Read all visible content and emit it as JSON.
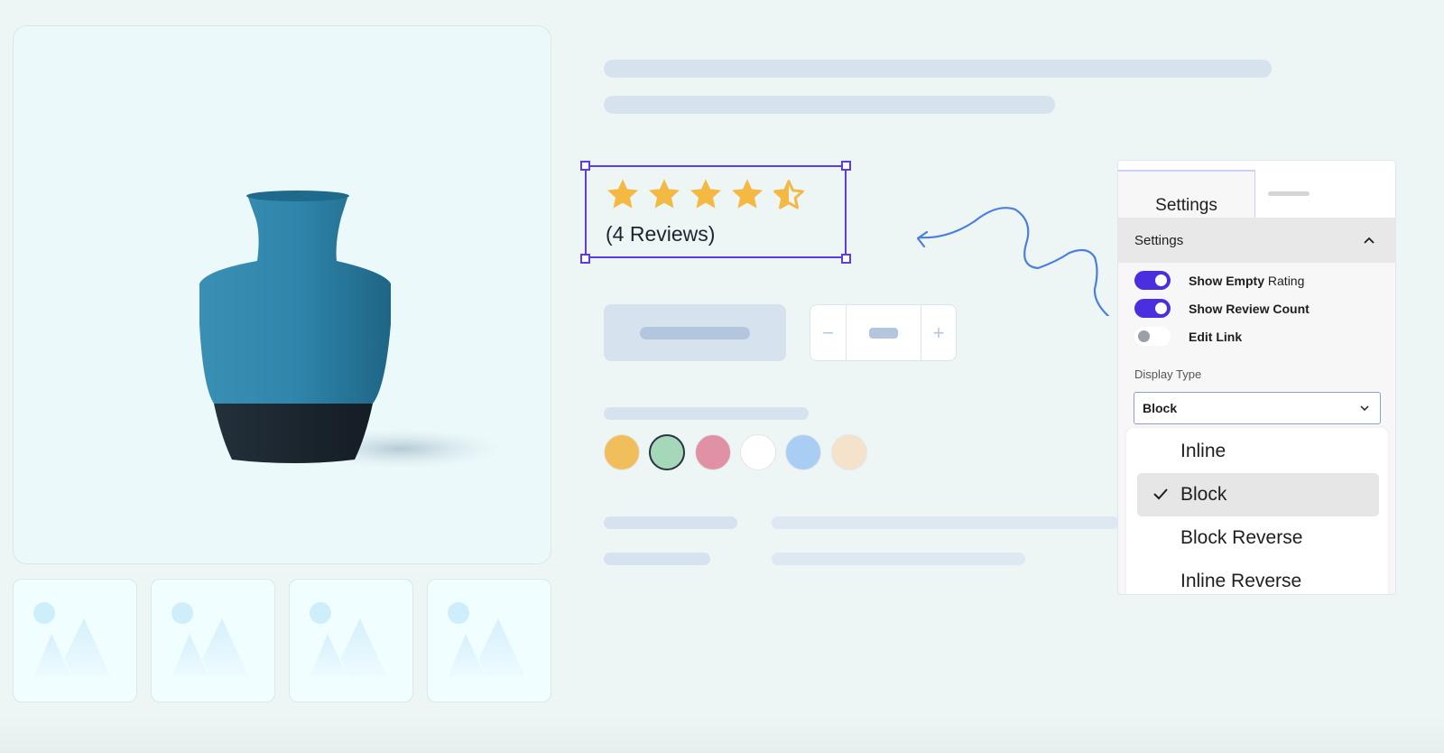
{
  "product": {
    "image_alt": "blue-ceramic-vase",
    "thumbnail_count": 4
  },
  "rating": {
    "stars_value": 4.5,
    "stars_max": 5,
    "reviews_label": "(4 Reviews)",
    "star_color": "#f4b942",
    "selection_color": "#5a3de6"
  },
  "quantity": {
    "minus_symbol": "−",
    "plus_symbol": "+"
  },
  "swatches": [
    {
      "name": "yellow",
      "color": "#f0be5a",
      "selected": false
    },
    {
      "name": "green",
      "color": "#a4d8b9",
      "selected": true
    },
    {
      "name": "pink",
      "color": "#e091a6",
      "selected": false
    },
    {
      "name": "white",
      "color": "#ffffff",
      "selected": false
    },
    {
      "name": "blue",
      "color": "#a9cdf3",
      "selected": false
    },
    {
      "name": "cream",
      "color": "#f4e2ca",
      "selected": false
    }
  ],
  "panel": {
    "tab_active": "Settings",
    "section_title": "Settings",
    "toggles": [
      {
        "label_main": "Show Empty",
        "label_suffix": "Rating",
        "on": true
      },
      {
        "label_main": "Show Review Count",
        "label_suffix": "",
        "on": true
      },
      {
        "label_main": "Edit Link",
        "label_suffix": "",
        "on": false
      }
    ],
    "display_type_label": "Display Type",
    "display_type_value": "Block",
    "display_type_options": [
      {
        "label": "Inline",
        "selected": false
      },
      {
        "label": "Block",
        "selected": true
      },
      {
        "label": "Block Reverse",
        "selected": false
      },
      {
        "label": "Inline Reverse",
        "selected": false
      }
    ]
  },
  "annotation": {
    "arrow_color": "#4a7fdc"
  }
}
